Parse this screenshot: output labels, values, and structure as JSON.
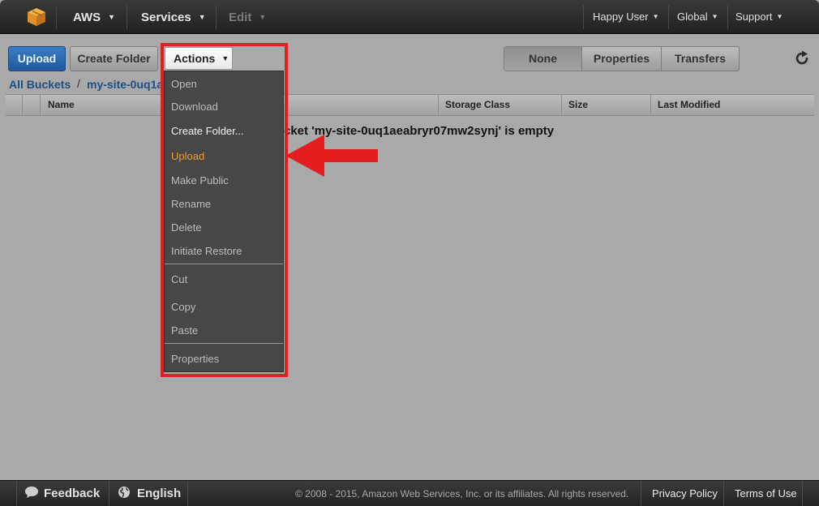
{
  "nav": {
    "brand_icon": "aws-cube-icon",
    "aws_label": "AWS",
    "services_label": "Services",
    "edit_label": "Edit",
    "user_label": "Happy User",
    "region_label": "Global",
    "support_label": "Support"
  },
  "toolbar": {
    "upload_label": "Upload",
    "create_folder_label": "Create Folder",
    "actions_label": "Actions",
    "panel_tabs": [
      {
        "label": "None",
        "active": true
      },
      {
        "label": "Properties",
        "active": false
      },
      {
        "label": "Transfers",
        "active": false
      }
    ],
    "refresh_icon": "refresh-icon"
  },
  "breadcrumb": {
    "root": "All Buckets",
    "separator": "/",
    "bucket": "my-site-0uq1a"
  },
  "table": {
    "columns": [
      "Name",
      "Storage Class",
      "Size",
      "Last Modified"
    ],
    "empty_message": "cket 'my-site-0uq1aeabryr07mw2synj' is empty"
  },
  "actions_menu": {
    "items": [
      {
        "label": "Open",
        "state": "disabled"
      },
      {
        "label": "Download",
        "state": "disabled"
      },
      {
        "label": "Create Folder...",
        "state": "enabled"
      },
      {
        "label": "Upload",
        "state": "highlighted"
      },
      {
        "label": "Make Public",
        "state": "disabled"
      },
      {
        "label": "Rename",
        "state": "disabled"
      },
      {
        "label": "Delete",
        "state": "disabled"
      },
      {
        "label": "Initiate Restore",
        "state": "disabled"
      },
      {
        "label": "Cut",
        "state": "disabled"
      },
      {
        "label": "Copy",
        "state": "disabled"
      },
      {
        "label": "Paste",
        "state": "disabled"
      },
      {
        "label": "Properties",
        "state": "disabled"
      }
    ]
  },
  "annotation": {
    "highlight_color": "#e41e1e"
  },
  "footer": {
    "feedback_label": "Feedback",
    "language_label": "English",
    "copyright": "© 2008 - 2015, Amazon Web Services, Inc. or its affiliates. All rights reserved.",
    "privacy_label": "Privacy Policy",
    "terms_label": "Terms of Use"
  },
  "colors": {
    "accent_blue": "#1f5a9c",
    "link_blue": "#1c4f86",
    "menu_highlight": "#f39a33"
  }
}
